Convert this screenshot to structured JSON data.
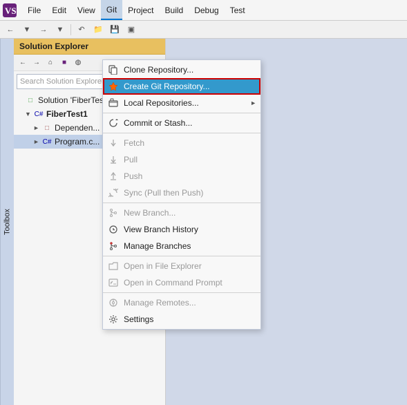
{
  "menubar": {
    "items": [
      {
        "id": "file",
        "label": "File"
      },
      {
        "id": "edit",
        "label": "Edit"
      },
      {
        "id": "view",
        "label": "View"
      },
      {
        "id": "git",
        "label": "Git",
        "active": true
      },
      {
        "id": "project",
        "label": "Project"
      },
      {
        "id": "build",
        "label": "Build"
      },
      {
        "id": "debug",
        "label": "Debug"
      },
      {
        "id": "test",
        "label": "Test"
      }
    ]
  },
  "toolbox": {
    "label": "Toolbox"
  },
  "solution_explorer": {
    "title": "Solution Explorer",
    "search_placeholder": "Search Solution Explorer",
    "tree": [
      {
        "indent": 0,
        "icon": "solution-icon",
        "label": "Solution 'FiberTest",
        "arrow": "none"
      },
      {
        "indent": 1,
        "icon": "cs-project-icon",
        "label": "FiberTest1",
        "arrow": "down",
        "bold": true
      },
      {
        "indent": 2,
        "icon": "dependency-icon",
        "label": "Dependen...",
        "arrow": "right"
      },
      {
        "indent": 2,
        "icon": "cs-file-icon",
        "label": "Program.c...",
        "arrow": "right",
        "selected": true
      }
    ]
  },
  "dropdown": {
    "items": [
      {
        "id": "clone-repo",
        "label": "Clone Repository...",
        "icon": "clone-icon",
        "disabled": false,
        "arrow": false
      },
      {
        "id": "create-git-repo",
        "label": "Create Git Repository...",
        "icon": "git-repo-icon",
        "disabled": false,
        "highlighted": true,
        "border": true,
        "arrow": false
      },
      {
        "id": "local-repos",
        "label": "Local Repositories...",
        "icon": "local-repo-icon",
        "disabled": false,
        "arrow": true
      },
      {
        "id": "separator1",
        "type": "separator"
      },
      {
        "id": "commit-stash",
        "label": "Commit or Stash...",
        "icon": "commit-icon",
        "disabled": false,
        "arrow": false
      },
      {
        "id": "separator2",
        "type": "separator"
      },
      {
        "id": "fetch",
        "label": "Fetch",
        "icon": "fetch-icon",
        "disabled": true,
        "arrow": false
      },
      {
        "id": "pull",
        "label": "Pull",
        "icon": "pull-icon",
        "disabled": true,
        "arrow": false
      },
      {
        "id": "push",
        "label": "Push",
        "icon": "push-icon",
        "disabled": true,
        "arrow": false
      },
      {
        "id": "sync",
        "label": "Sync (Pull then Push)",
        "icon": "sync-icon",
        "disabled": true,
        "arrow": false
      },
      {
        "id": "separator3",
        "type": "separator"
      },
      {
        "id": "new-branch",
        "label": "New Branch...",
        "icon": "branch-icon",
        "disabled": true,
        "arrow": false
      },
      {
        "id": "view-branch-history",
        "label": "View Branch History",
        "icon": "history-icon",
        "disabled": false,
        "arrow": false
      },
      {
        "id": "manage-branches",
        "label": "Manage Branches",
        "icon": "manage-branch-icon",
        "disabled": false,
        "arrow": false
      },
      {
        "id": "separator4",
        "type": "separator"
      },
      {
        "id": "open-file-explorer",
        "label": "Open in File Explorer",
        "icon": "folder-icon",
        "disabled": true,
        "arrow": false
      },
      {
        "id": "open-cmd",
        "label": "Open in Command Prompt",
        "icon": "cmd-icon",
        "disabled": true,
        "arrow": false
      },
      {
        "id": "separator5",
        "type": "separator"
      },
      {
        "id": "manage-remotes",
        "label": "Manage Remotes...",
        "icon": "remote-icon",
        "disabled": true,
        "arrow": false
      },
      {
        "id": "settings",
        "label": "Settings",
        "icon": "settings-icon",
        "disabled": false,
        "arrow": false
      }
    ]
  },
  "icons": {
    "clone-icon": "⬇",
    "git-repo-icon": "🔸",
    "local-repo-icon": "📁",
    "commit-icon": "↩",
    "fetch-icon": "⬇",
    "pull-icon": "⬇",
    "push-icon": "⬆",
    "sync-icon": "🔄",
    "branch-icon": "✦",
    "history-icon": "↺",
    "manage-branch-icon": "🔴",
    "folder-icon": "📂",
    "cmd-icon": "▣",
    "remote-icon": "⚙",
    "settings-icon": "⚙"
  }
}
